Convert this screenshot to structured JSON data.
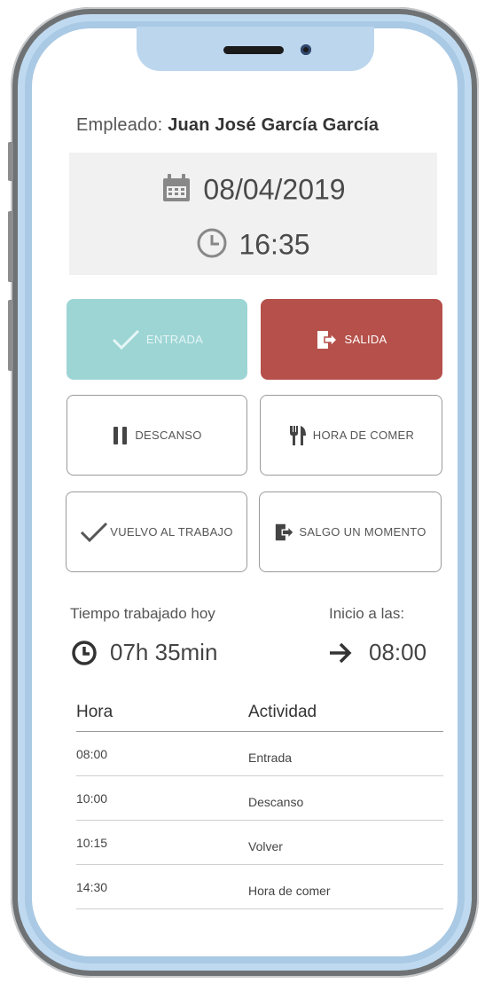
{
  "employee": {
    "label": "Empleado:",
    "name": "Juan José García García"
  },
  "clock": {
    "date": "08/04/2019",
    "time": "16:35",
    "date_icon": "calendar-icon",
    "time_icon": "clock-icon"
  },
  "actions": {
    "entrada": {
      "label": "ENTRADA",
      "icon": "check-icon",
      "color": "#9dd5d5",
      "disabled": true
    },
    "salida": {
      "label": "SALIDA",
      "icon": "exit-door-icon",
      "color": "#b5504a"
    },
    "descanso": {
      "label": "DESCANSO",
      "icon": "pause-icon"
    },
    "comer": {
      "label": "HORA DE COMER",
      "icon": "fork-knife-icon"
    },
    "vuelvo": {
      "label": "VUELVO AL TRABAJO",
      "icon": "check-icon"
    },
    "salgo": {
      "label": "SALGO UN MOMENTO",
      "icon": "exit-door-icon"
    }
  },
  "summary": {
    "worked_label": "Tiempo trabajado hoy",
    "worked_value": "07h 35min",
    "start_label": "Inicio a las:",
    "start_value": "08:00"
  },
  "activity_table": {
    "headers": [
      "Hora",
      "Actividad"
    ],
    "rows": [
      {
        "hora": "08:00",
        "actividad": "Entrada"
      },
      {
        "hora": "10:00",
        "actividad": "Descanso"
      },
      {
        "hora": "10:15",
        "actividad": "Volver"
      },
      {
        "hora": "14:30",
        "actividad": "Hora de comer"
      }
    ]
  }
}
